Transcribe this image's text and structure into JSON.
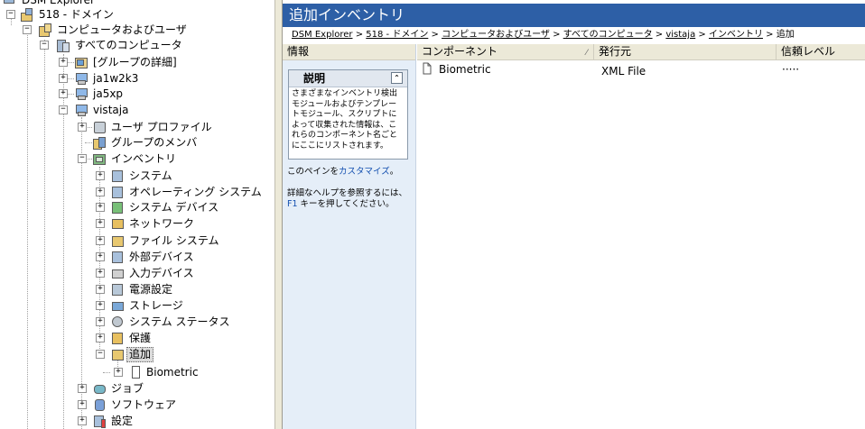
{
  "tree": {
    "top_partial": "DSM Explorer",
    "domain": "518 - ドメイン",
    "computers_users": "コンピュータおよびユーザ",
    "all_computers": "すべてのコンピュータ",
    "group_details": "[グループの詳細]",
    "ja1w2k3": "ja1w2k3",
    "ja5xp": "ja5xp",
    "vistaja": "vistaja",
    "user_profile": "ユーザ プロファイル",
    "group_member": "グループのメンバ",
    "inventory": "インベントリ",
    "inv_items": [
      "システム",
      "オペレーティング システム",
      "システム デバイス",
      "ネットワーク",
      "ファイル システム",
      "外部デバイス",
      "入力デバイス",
      "電源設定",
      "ストレージ",
      "システム ステータス",
      "保護"
    ],
    "additional": "追加",
    "biometric": "Biometric",
    "job": "ジョブ",
    "software": "ソフトウェア",
    "settings": "設定"
  },
  "right": {
    "title": "追加インベントリ",
    "breadcrumb": {
      "links": [
        "DSM Explorer",
        "518 - ドメイン",
        "コンピュータおよびユーザ",
        "すべてのコンピュータ",
        "vistaja",
        "インベントリ"
      ],
      "sep": ">",
      "current": "追加"
    },
    "info": {
      "header": "情報",
      "desc_title": "説明",
      "desc_text": "さまざまなインベントリ検出モジュールおよびテンプレートモジュール、スクリプトによって収集された情報は、これらのコンポーネント名ごとにここにリストされます。",
      "customize_prefix": "このペインを",
      "customize_link": "カスタマイズ",
      "customize_suffix": "。",
      "help_prefix": "詳細なヘルプを参照するには、",
      "help_key": "F1",
      "help_suffix": " キーを押してください。"
    },
    "columns": [
      "コンポーネント",
      "発行元",
      "信頼レベル"
    ],
    "rows": [
      {
        "component": "Biometric",
        "publisher": "XML File",
        "trust": "·····"
      }
    ]
  },
  "colors": {
    "title_bar": "#2d5fa6",
    "panel_bg": "#e5eef8",
    "link": "#1450b0"
  }
}
